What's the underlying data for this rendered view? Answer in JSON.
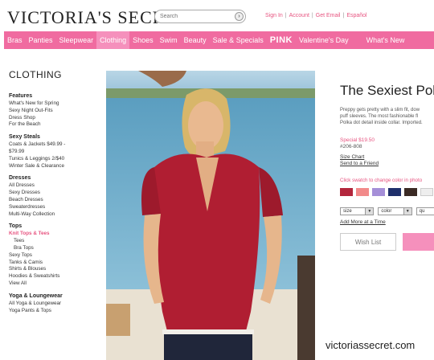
{
  "header": {
    "logo": "VICTORIA'S SECRET",
    "search_placeholder": "Search",
    "search_go": "›",
    "links": [
      "Sign In",
      "Account",
      "Get Email",
      "Español"
    ],
    "link_separator": "|"
  },
  "nav": {
    "items": [
      "Bras",
      "Panties",
      "Sleepwear",
      "Clothing",
      "Shoes",
      "Swim",
      "Beauty",
      "Sale & Specials",
      "PINK",
      "Valentine's Day",
      "What's New"
    ]
  },
  "sidebar": {
    "title": "CLOTHING",
    "groups": [
      {
        "head": "Features",
        "links": [
          "What's New for Spring",
          "Sexy Night Out-Fits",
          "Dress Shop",
          "For the Beach"
        ]
      },
      {
        "head": "Sexy Steals",
        "links": [
          "Coats & Jackets $49.99 -",
          "$79.99",
          "Tunics & Leggings 2/$40",
          "Winter Sale & Clearance"
        ]
      },
      {
        "head": "Dresses",
        "links": [
          "All Dresses",
          "Sexy Dresses",
          "Beach Dresses",
          "Sweaterdresses",
          "Multi-Way Collection"
        ]
      },
      {
        "head": "Tops",
        "links": [
          "Knit Tops & Tees",
          "Tees",
          "Bra Tops",
          "Sexy Tops",
          "Tanks & Camis",
          "Shirts & Blouses",
          "Hoodies & Sweatshirts",
          "View All"
        ]
      },
      {
        "head": "Yoga & Loungewear",
        "links": [
          "All Yoga & Loungewear",
          "Yoga Pants & Tops"
        ]
      }
    ]
  },
  "product": {
    "title": "The Sexiest Polo",
    "description": [
      "Preppy gets pretty with a slim fit, dow",
      "puff sleeves. The most fashionable fl",
      "Polka dot detail inside collar. Imported."
    ],
    "price": "Special $19.50",
    "sku": "#206-808",
    "size_chart": "Size Chart",
    "send_friend": "Send to a Friend",
    "swatch_label": "Click swatch to change color in photo",
    "swatches": [
      "#b3263c",
      "#f28a8a",
      "#a58fd8",
      "#1f2f6b",
      "#3b2a24",
      "#eeeeee"
    ],
    "size_label": "size",
    "color_label": "color",
    "qty_label": "qu",
    "add_more": "Add More at a Time",
    "wish_list": "Wish List",
    "accent": "#e75480"
  },
  "watermark": "victoriassecret.com",
  "colors": {
    "nav_bg": "#f06ba0",
    "nav_active": "#f590bc"
  }
}
